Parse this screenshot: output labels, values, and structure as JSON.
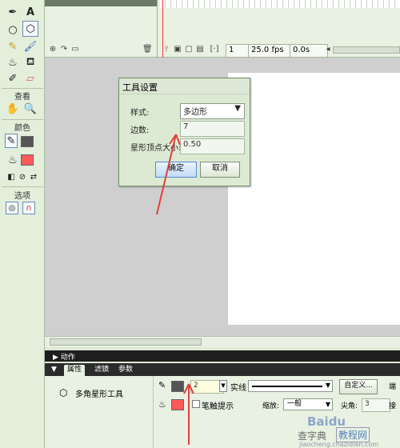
{
  "sections": {
    "view": "查看",
    "colors": "颜色",
    "options": "选项"
  },
  "timeline": {
    "frame": "1",
    "fps": "25.0 fps",
    "time": "0.0s"
  },
  "dialog": {
    "title": "工具设置",
    "style_label": "样式:",
    "style_value": "多边形",
    "sides_label": "边数:",
    "sides_value": "7",
    "star_label": "星形顶点大小:",
    "star_value": "0.50",
    "ok": "确定",
    "cancel": "取消"
  },
  "panel": {
    "actions": "动作",
    "tabs": [
      "属性",
      "滤镜",
      "参数"
    ],
    "tool_name": "多角星形工具",
    "stroke_width": "2",
    "stroke_style": "实线",
    "custom_button": "自定义...",
    "end_label": "端",
    "hinting_label": "笔触提示",
    "scale_label": "缩放:",
    "scale_value": "一般",
    "miter_label": "尖角:",
    "miter_value": "3",
    "join_label": "接"
  },
  "colors": {
    "stroke": "#555555",
    "fill": "#ff5a5a",
    "annotation": "#e0413a",
    "dialog_bg": "#dcead3"
  },
  "watermark": {
    "line1": "Baidu",
    "line2": "查字典",
    "line3": "教程网",
    "line4": "jiaocheng.chazidian.com"
  }
}
